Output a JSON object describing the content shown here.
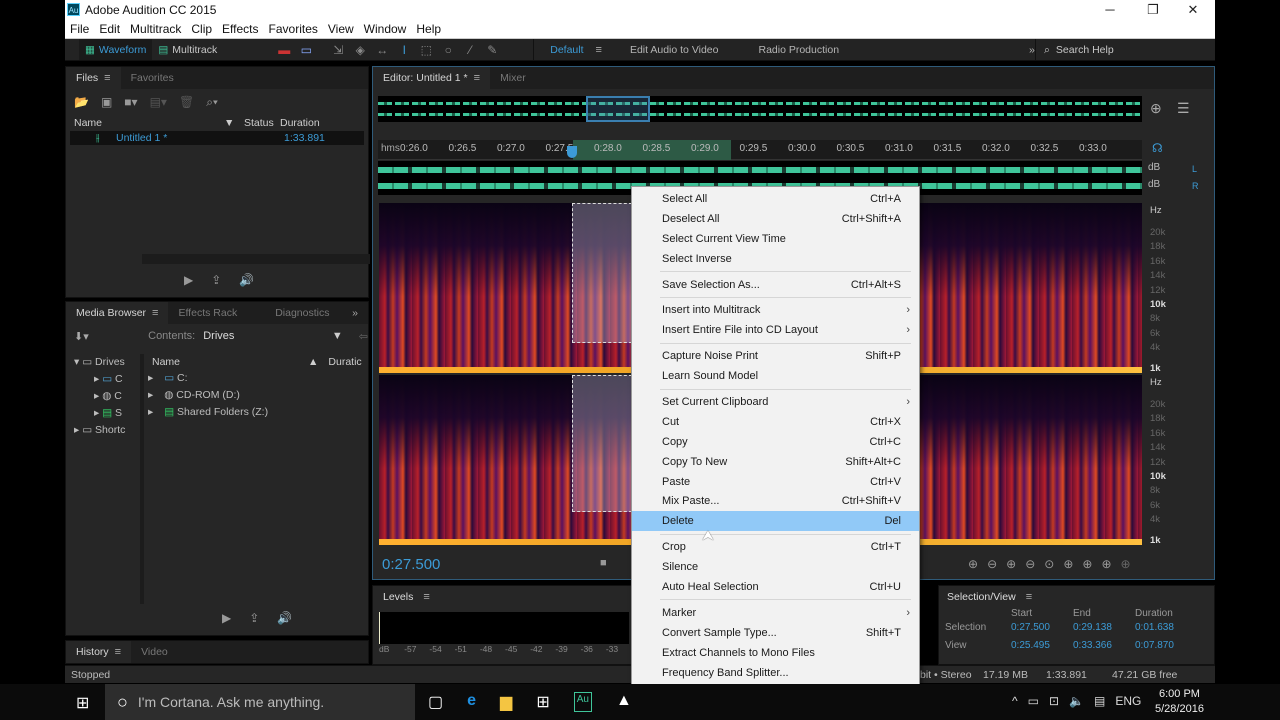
{
  "window": {
    "title": "Adobe Audition CC 2015",
    "app_icon": "Au",
    "minimize": "─",
    "maximize": "❐",
    "close": "✕"
  },
  "menu": [
    "File",
    "Edit",
    "Multitrack",
    "Clip",
    "Effects",
    "Favorites",
    "View",
    "Window",
    "Help"
  ],
  "toolbar": {
    "waveform": "Waveform",
    "multitrack": "Multitrack",
    "workspaces": [
      "Default",
      "Edit Audio to Video",
      "Radio Production"
    ],
    "more": "»",
    "search_placeholder": "Search Help"
  },
  "files": {
    "tabs": [
      "Files",
      "Favorites"
    ],
    "columns": [
      "Name",
      "Status",
      "Duration"
    ],
    "rows": [
      {
        "name": "Untitled 1 *",
        "status": "",
        "duration": "1:33.891"
      }
    ]
  },
  "media": {
    "tabs": [
      "Media Browser",
      "Effects Rack",
      "Diagnostics"
    ],
    "contents_label": "Contents:",
    "contents_value": "Drives",
    "tree": [
      {
        "label": "Drives"
      },
      {
        "label": "C"
      },
      {
        "label": "C"
      },
      {
        "label": "S"
      },
      {
        "label": "Shortc"
      }
    ],
    "columns": [
      "Name",
      "Duratic"
    ],
    "items": [
      "C:",
      "CD-ROM (D:)",
      "Shared Folders (Z:)"
    ]
  },
  "history": {
    "tabs": [
      "History",
      "Video"
    ]
  },
  "editor": {
    "tabs": [
      "Editor: Untitled 1 *",
      "Mixer"
    ],
    "ruler_unit": "hms",
    "ruler_ticks": [
      "0:26.0",
      "0:26.5",
      "0:27.0",
      "0:27.5",
      "0:28.0",
      "0:28.5",
      "0:29.0",
      "0:29.5",
      "0:30.0",
      "0:30.5",
      "0:31.0",
      "0:31.5",
      "0:32.0",
      "0:32.5",
      "0:33.0"
    ],
    "db_label": "dB",
    "channels": [
      "L",
      "R"
    ],
    "hz_label": "Hz",
    "hz_ticks": [
      "20k",
      "18k",
      "16k",
      "14k",
      "12k",
      "10k",
      "8k",
      "6k",
      "4k",
      "1k"
    ],
    "current_time": "0:27.500"
  },
  "context_menu": {
    "groups": [
      [
        {
          "label": "Select All",
          "shortcut": "Ctrl+A"
        },
        {
          "label": "Deselect All",
          "shortcut": "Ctrl+Shift+A"
        },
        {
          "label": "Select Current View Time",
          "shortcut": ""
        },
        {
          "label": "Select Inverse",
          "shortcut": ""
        }
      ],
      [
        {
          "label": "Save Selection As...",
          "shortcut": "Ctrl+Alt+S"
        }
      ],
      [
        {
          "label": "Insert into Multitrack",
          "shortcut": "",
          "submenu": true
        },
        {
          "label": "Insert Entire File into CD Layout",
          "shortcut": "",
          "submenu": true
        }
      ],
      [
        {
          "label": "Capture Noise Print",
          "shortcut": "Shift+P"
        },
        {
          "label": "Learn Sound Model",
          "shortcut": ""
        }
      ],
      [
        {
          "label": "Set Current Clipboard",
          "shortcut": "",
          "submenu": true
        },
        {
          "label": "Cut",
          "shortcut": "Ctrl+X"
        },
        {
          "label": "Copy",
          "shortcut": "Ctrl+C"
        },
        {
          "label": "Copy To New",
          "shortcut": "Shift+Alt+C"
        },
        {
          "label": "Paste",
          "shortcut": "Ctrl+V"
        },
        {
          "label": "Mix Paste...",
          "shortcut": "Ctrl+Shift+V"
        },
        {
          "label": "Delete",
          "shortcut": "Del",
          "highlighted": true
        }
      ],
      [
        {
          "label": "Crop",
          "shortcut": "Ctrl+T"
        },
        {
          "label": "Silence",
          "shortcut": ""
        },
        {
          "label": "Auto Heal Selection",
          "shortcut": "Ctrl+U"
        }
      ],
      [
        {
          "label": "Marker",
          "shortcut": "",
          "submenu": true
        },
        {
          "label": "Convert Sample Type...",
          "shortcut": "Shift+T"
        },
        {
          "label": "Extract Channels to Mono Files",
          "shortcut": ""
        },
        {
          "label": "Frequency Band Splitter...",
          "shortcut": ""
        }
      ]
    ]
  },
  "levels": {
    "title": "Levels",
    "ticks": [
      "dB",
      "-57",
      "-54",
      "-51",
      "-48",
      "-45",
      "-42",
      "-39",
      "-36",
      "-33"
    ]
  },
  "selection_view": {
    "title": "Selection/View",
    "columns": [
      "Start",
      "End",
      "Duration"
    ],
    "rows": [
      {
        "label": "Selection",
        "start": "0:27.500",
        "end": "0:29.138",
        "duration": "0:01.638"
      },
      {
        "label": "View",
        "start": "0:25.495",
        "end": "0:33.366",
        "duration": "0:07.870"
      }
    ]
  },
  "status": {
    "left": "Stopped",
    "format": "bit • Stereo",
    "size": "17.19 MB",
    "duration": "1:33.891",
    "free": "47.21 GB free"
  },
  "taskbar": {
    "cortana": "I'm Cortana. Ask me anything.",
    "lang": "ENG",
    "time": "6:00 PM",
    "date": "5/28/2016"
  }
}
